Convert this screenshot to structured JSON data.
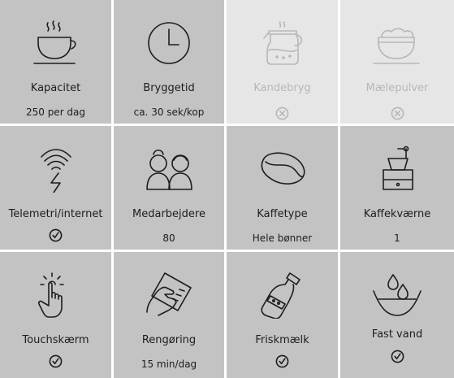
{
  "tiles": [
    {
      "icon": "coffee-cup-icon",
      "label": "Kapacitet",
      "value": "250 per dag"
    },
    {
      "icon": "clock-icon",
      "label": "Bryggetid",
      "value": "ca. 30 sek/kop"
    },
    {
      "icon": "coffee-pot-icon",
      "label": "Kandebryg",
      "status": "unavailable"
    },
    {
      "icon": "milk-foam-cup-icon",
      "label": "Mælepulver",
      "status": "unavailable"
    },
    {
      "icon": "wireless-signal-icon",
      "label": "Telemetri/internet",
      "status": "available"
    },
    {
      "icon": "people-icon",
      "label": "Medarbejdere",
      "value": "80"
    },
    {
      "icon": "coffee-bean-icon",
      "label": "Kaffetype",
      "value": "Hele bønner"
    },
    {
      "icon": "coffee-grinder-icon",
      "label": "Kaffekværne",
      "value": "1"
    },
    {
      "icon": "touch-hand-icon",
      "label": "Touchskærm",
      "status": "available"
    },
    {
      "icon": "cleaning-hand-icon",
      "label": "Rengøring",
      "value": "15 min/dag"
    },
    {
      "icon": "milk-bottle-icon",
      "label": "Friskmælk",
      "status": "available"
    },
    {
      "icon": "water-drops-icon",
      "label": "Fast vand",
      "status": "available"
    }
  ],
  "colors": {
    "tile": "#c3c3c3",
    "tile_disabled": "#e6e6e6",
    "text": "#1d1d1d",
    "text_disabled": "#b7b7b7",
    "gap": "#ffffff"
  }
}
